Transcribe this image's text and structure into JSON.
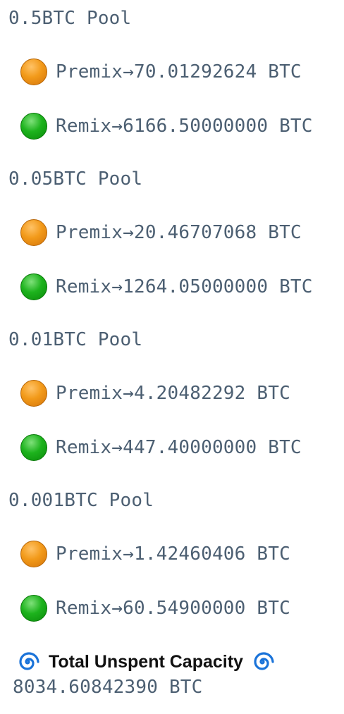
{
  "pools": [
    {
      "title": "0.5BTC Pool",
      "premix": "Premix→70.01292624 BTC",
      "remix": "Remix→6166.50000000 BTC"
    },
    {
      "title": "0.05BTC Pool",
      "premix": "Premix→20.46707068 BTC",
      "remix": "Remix→1264.05000000 BTC"
    },
    {
      "title": "0.01BTC Pool",
      "premix": "Premix→4.20482292 BTC",
      "remix": "Remix→447.40000000 BTC"
    },
    {
      "title": "0.001BTC Pool",
      "premix": "Premix→1.42460406 BTC",
      "remix": "Remix→60.54900000 BTC"
    }
  ],
  "icons": {
    "premix": "orange-circle-icon",
    "remix": "green-circle-icon",
    "total": "cyclone-icon"
  },
  "colors": {
    "text": "#4c5f72",
    "premix": "#f29a1a",
    "remix": "#1db31d",
    "label": "#111111",
    "cyclone": "#1a73d9"
  },
  "total": {
    "label": "Total Unspent Capacity",
    "value": "8034.60842390 BTC"
  }
}
